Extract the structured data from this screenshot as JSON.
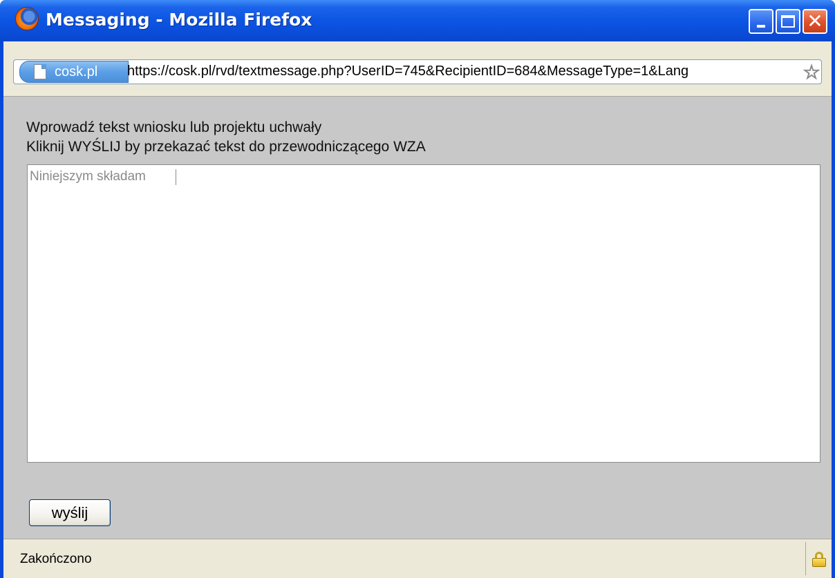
{
  "window": {
    "title": "Messaging - Mozilla Firefox",
    "icon": "firefox-icon",
    "controls": {
      "minimize": "minimize-icon",
      "maximize": "maximize-icon",
      "close": "close-icon",
      "close_glyph": "✕"
    }
  },
  "addressbar": {
    "site": "cosk.pl",
    "url": "https://cosk.pl/rvd/textmessage.php?UserID=745&RecipientID=684&MessageType=1&Lang",
    "star_glyph": "☆"
  },
  "form": {
    "instruction_line1": "Wprowadź tekst wniosku lub projektu uchwały",
    "instruction_line2": "Kliknij WYŚLIJ by przekazać tekst do przewodniczącego WZA",
    "message_value": "Niniejszym składam",
    "send_label": "wyślij"
  },
  "statusbar": {
    "text": "Zakończono",
    "icon": "lock-icon"
  },
  "colors": {
    "titlebar": "#0a4cd8",
    "content_bg": "#c8c8c8",
    "chrome_bg": "#ece9d8"
  }
}
